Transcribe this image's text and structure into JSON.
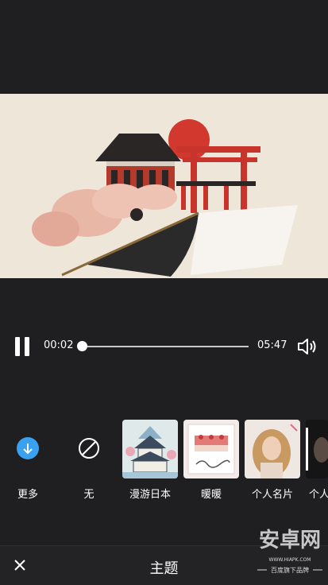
{
  "player": {
    "current_time": "00:02",
    "duration": "05:47",
    "progress": 0.006
  },
  "themes": {
    "items": [
      {
        "label": "更多",
        "icon": "download-icon"
      },
      {
        "label": "无",
        "icon": "none-icon"
      },
      {
        "label": "漫游日本",
        "icon": "japan-castle-thumbnail"
      },
      {
        "label": "暖暖",
        "icon": "afternoon-cake-thumbnail"
      },
      {
        "label": "个人名片",
        "icon": "portrait-thumbnail"
      },
      {
        "label": "个人",
        "icon": "portrait-dark-thumbnail"
      }
    ]
  },
  "bottom_bar": {
    "title": "主题",
    "close_icon": "close-icon"
  },
  "watermark": {
    "logo_text": "安卓网",
    "tagline": "百度旗下品牌"
  },
  "colors": {
    "background": "#1f1f21",
    "accent_blue": "#3aa0f0",
    "torii_red": "#c8342c"
  }
}
